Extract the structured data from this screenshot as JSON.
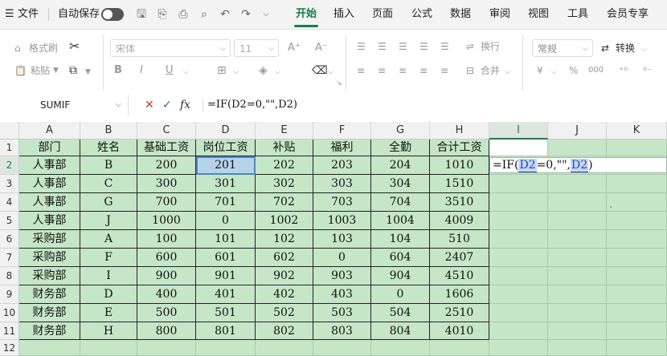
{
  "menubar": {
    "hamburger": "☰",
    "file": "文件",
    "autosave": "自动保存",
    "tabs": [
      "开始",
      "插入",
      "页面",
      "公式",
      "数据",
      "审阅",
      "视图",
      "工具",
      "会员专享"
    ],
    "active_tab": "开始"
  },
  "ribbon": {
    "format_painter": "格式刷",
    "paste": "粘贴",
    "font_name": "宋体",
    "font_size": "11",
    "font_grow": "A⁺",
    "font_shrink": "A⁻",
    "bold": "B",
    "italic": "I",
    "underline": "U",
    "wrap": "换行",
    "merge": "合并",
    "number_format": "常规",
    "convert": "转换",
    "percent": "%",
    "comma": "000"
  },
  "formula_bar": {
    "name_box": "SUMIF",
    "fx": "fx",
    "formula": "=IF(D2=0,\"\",D2)"
  },
  "sheet": {
    "columns": [
      "A",
      "B",
      "C",
      "D",
      "E",
      "F",
      "G",
      "H",
      "I",
      "J",
      "K"
    ],
    "rows": [
      "1",
      "2",
      "3",
      "4",
      "5",
      "6",
      "7",
      "8",
      "9",
      "10",
      "11",
      "12"
    ],
    "headers": [
      "部门",
      "姓名",
      "基础工资",
      "岗位工资",
      "补贴",
      "福利",
      "全勤",
      "合计工资"
    ],
    "data": [
      [
        "人事部",
        "B",
        "200",
        "201",
        "202",
        "203",
        "204",
        "1010"
      ],
      [
        "人事部",
        "C",
        "300",
        "301",
        "302",
        "303",
        "304",
        "1510"
      ],
      [
        "人事部",
        "G",
        "700",
        "701",
        "702",
        "703",
        "704",
        "3510"
      ],
      [
        "人事部",
        "J",
        "1000",
        "0",
        "1002",
        "1003",
        "1004",
        "4009"
      ],
      [
        "采购部",
        "A",
        "100",
        "101",
        "102",
        "103",
        "104",
        "510"
      ],
      [
        "采购部",
        "F",
        "600",
        "601",
        "602",
        "0",
        "604",
        "2407"
      ],
      [
        "采购部",
        "I",
        "900",
        "901",
        "902",
        "903",
        "904",
        "4510"
      ],
      [
        "财务部",
        "D",
        "400",
        "401",
        "402",
        "403",
        "0",
        "1606"
      ],
      [
        "财务部",
        "E",
        "500",
        "501",
        "502",
        "503",
        "504",
        "2510"
      ],
      [
        "财务部",
        "H",
        "800",
        "801",
        "802",
        "803",
        "804",
        "4010"
      ]
    ],
    "editing_cell": "I2",
    "edit_text": {
      "p1": "=IF(",
      "ref1": "D2",
      "p2": "=0,\"\",",
      "ref2": "D2",
      "p3": ")"
    },
    "selected_col": "I",
    "selected_row": "2"
  }
}
